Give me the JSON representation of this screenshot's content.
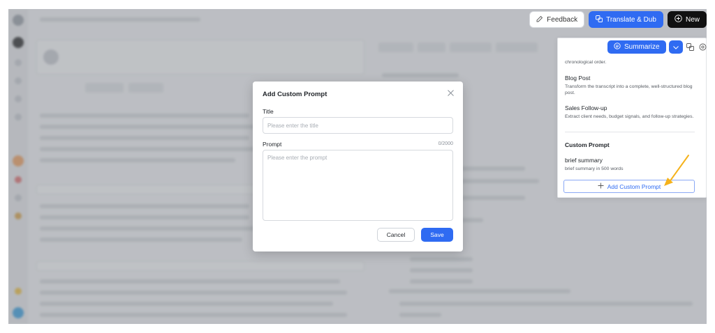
{
  "toolbar": {
    "feedback_label": "Feedback",
    "translate_label": "Translate & Dub",
    "new_label": "New"
  },
  "summarize": {
    "label": "Summarize"
  },
  "dropdown": {
    "top_partial_desc": "chronological order.",
    "items": [
      {
        "title": "Blog Post",
        "desc": "Transform the transcript into a complete, well-structured blog post."
      },
      {
        "title": "Sales Follow-up",
        "desc": "Extract client needs, budget signals, and follow-up strategies."
      }
    ],
    "custom_section_title": "Custom Prompt",
    "custom_items": [
      {
        "title": "brief summary",
        "desc": "brief summary in 500 words"
      }
    ],
    "add_button_label": "Add Custom Prompt"
  },
  "modal": {
    "title": "Add Custom Prompt",
    "title_field_label": "Title",
    "title_placeholder": "Please enter the title",
    "prompt_field_label": "Prompt",
    "prompt_counter": "0/2000",
    "prompt_placeholder": "Please enter the prompt",
    "cancel_label": "Cancel",
    "save_label": "Save"
  },
  "colors": {
    "accent": "#2f6bf2",
    "arrow": "#f5b21b"
  }
}
